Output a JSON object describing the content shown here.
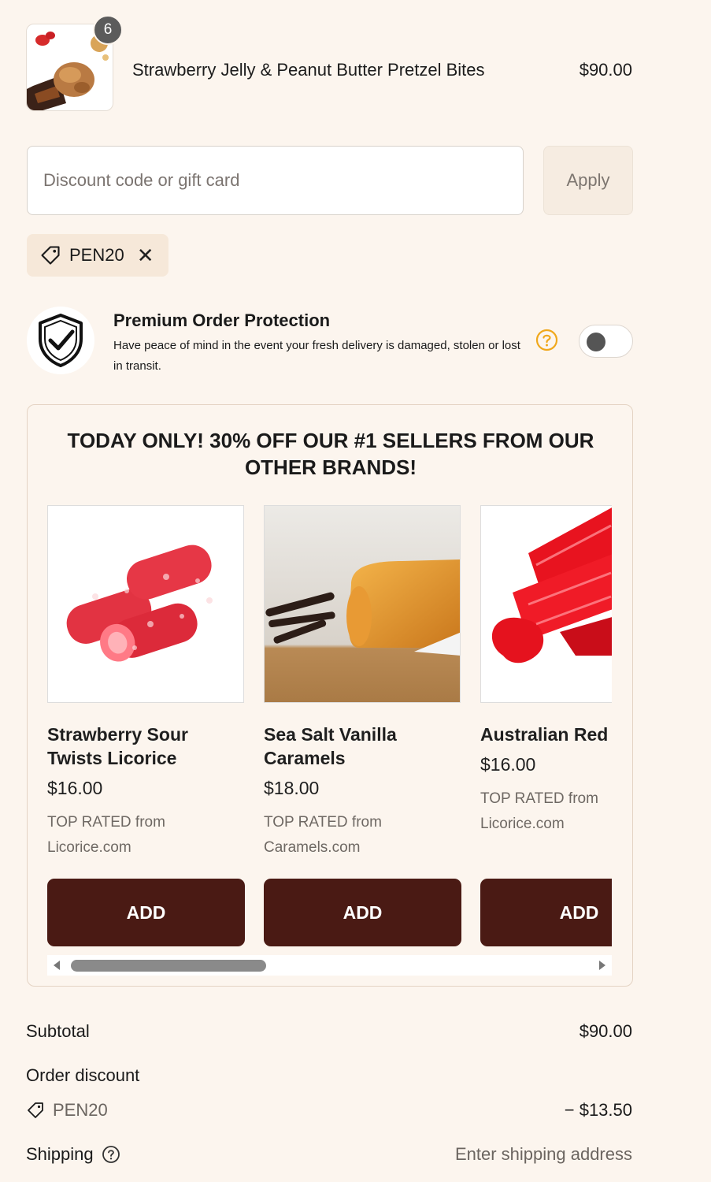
{
  "cart_item": {
    "quantity": "6",
    "title": "Strawberry Jelly & Peanut Butter Pretzel Bites",
    "price": "$90.00"
  },
  "discount": {
    "placeholder": "Discount code or gift card",
    "value": "",
    "apply_label": "Apply",
    "applied_code": "PEN20"
  },
  "protection": {
    "title": "Premium Order Protection",
    "description": "Have peace of mind in the event your fresh delivery is damaged, stolen or lost in transit.",
    "enabled": false
  },
  "upsell": {
    "title": "TODAY ONLY! 30% OFF OUR #1 SELLERS FROM OUR OTHER BRANDS!",
    "products": [
      {
        "name": "Strawberry Sour Twists Licorice",
        "price": "$16.00",
        "note": "TOP RATED from Licorice.com",
        "button": "ADD"
      },
      {
        "name": "Sea Salt Vanilla Caramels",
        "price": "$18.00",
        "note": "TOP RATED from Caramels.com",
        "button": "ADD"
      },
      {
        "name": "Australian Red",
        "price": "$16.00",
        "note": "TOP RATED from Licorice.com",
        "button": "ADD"
      }
    ]
  },
  "summary": {
    "subtotal_label": "Subtotal",
    "subtotal_value": "$90.00",
    "order_discount_label": "Order discount",
    "discount_code": "PEN20",
    "discount_value": "− $13.50",
    "shipping_label": "Shipping",
    "shipping_value": "Enter shipping address"
  },
  "colors": {
    "background": "#fcf5ee",
    "add_button": "#4a1a14",
    "help_icon": "#f0a81c"
  }
}
